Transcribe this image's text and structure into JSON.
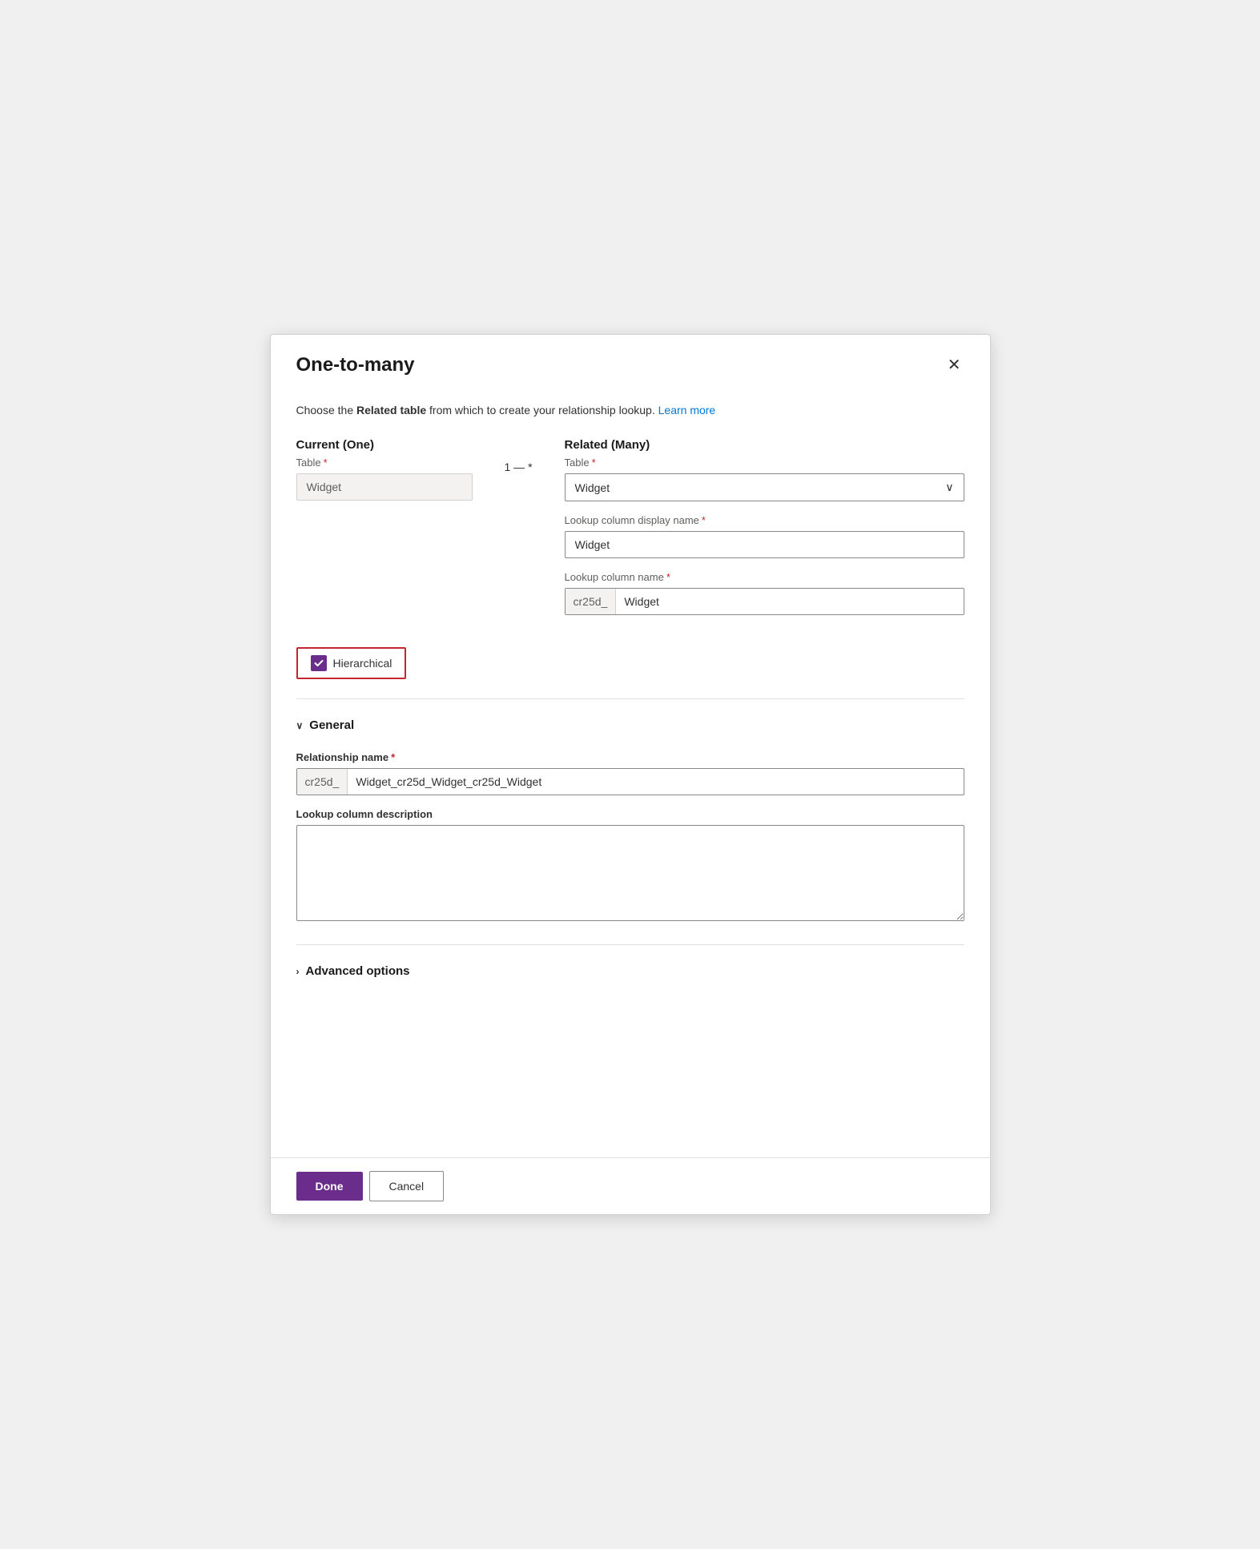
{
  "dialog": {
    "title": "One-to-many",
    "close_label": "×",
    "description_text": "Choose the ",
    "description_bold": "Related table",
    "description_end": " from which to create your relationship lookup.",
    "learn_more": "Learn more"
  },
  "current_section": {
    "header": "Current (One)",
    "table_label": "Table",
    "table_value": "Widget"
  },
  "arrow_text": "1 — *",
  "related_section": {
    "header": "Related (Many)",
    "table_label": "Table",
    "table_value": "Widget",
    "lookup_display_label": "Lookup column display name",
    "lookup_display_value": "Widget",
    "lookup_name_label": "Lookup column name",
    "lookup_name_prefix": "cr25d_",
    "lookup_name_value": "Widget"
  },
  "hierarchical": {
    "label": "Hierarchical",
    "checked": true
  },
  "general_section": {
    "header": "General",
    "expanded": true,
    "relationship_name_label": "Relationship name",
    "relationship_name_required": true,
    "relationship_name_prefix": "cr25d_",
    "relationship_name_value": "Widget_cr25d_Widget_cr25d_Widget",
    "lookup_description_label": "Lookup column description",
    "lookup_description_value": ""
  },
  "advanced_options": {
    "header": "Advanced options",
    "expanded": false
  },
  "footer": {
    "done_label": "Done",
    "cancel_label": "Cancel"
  }
}
